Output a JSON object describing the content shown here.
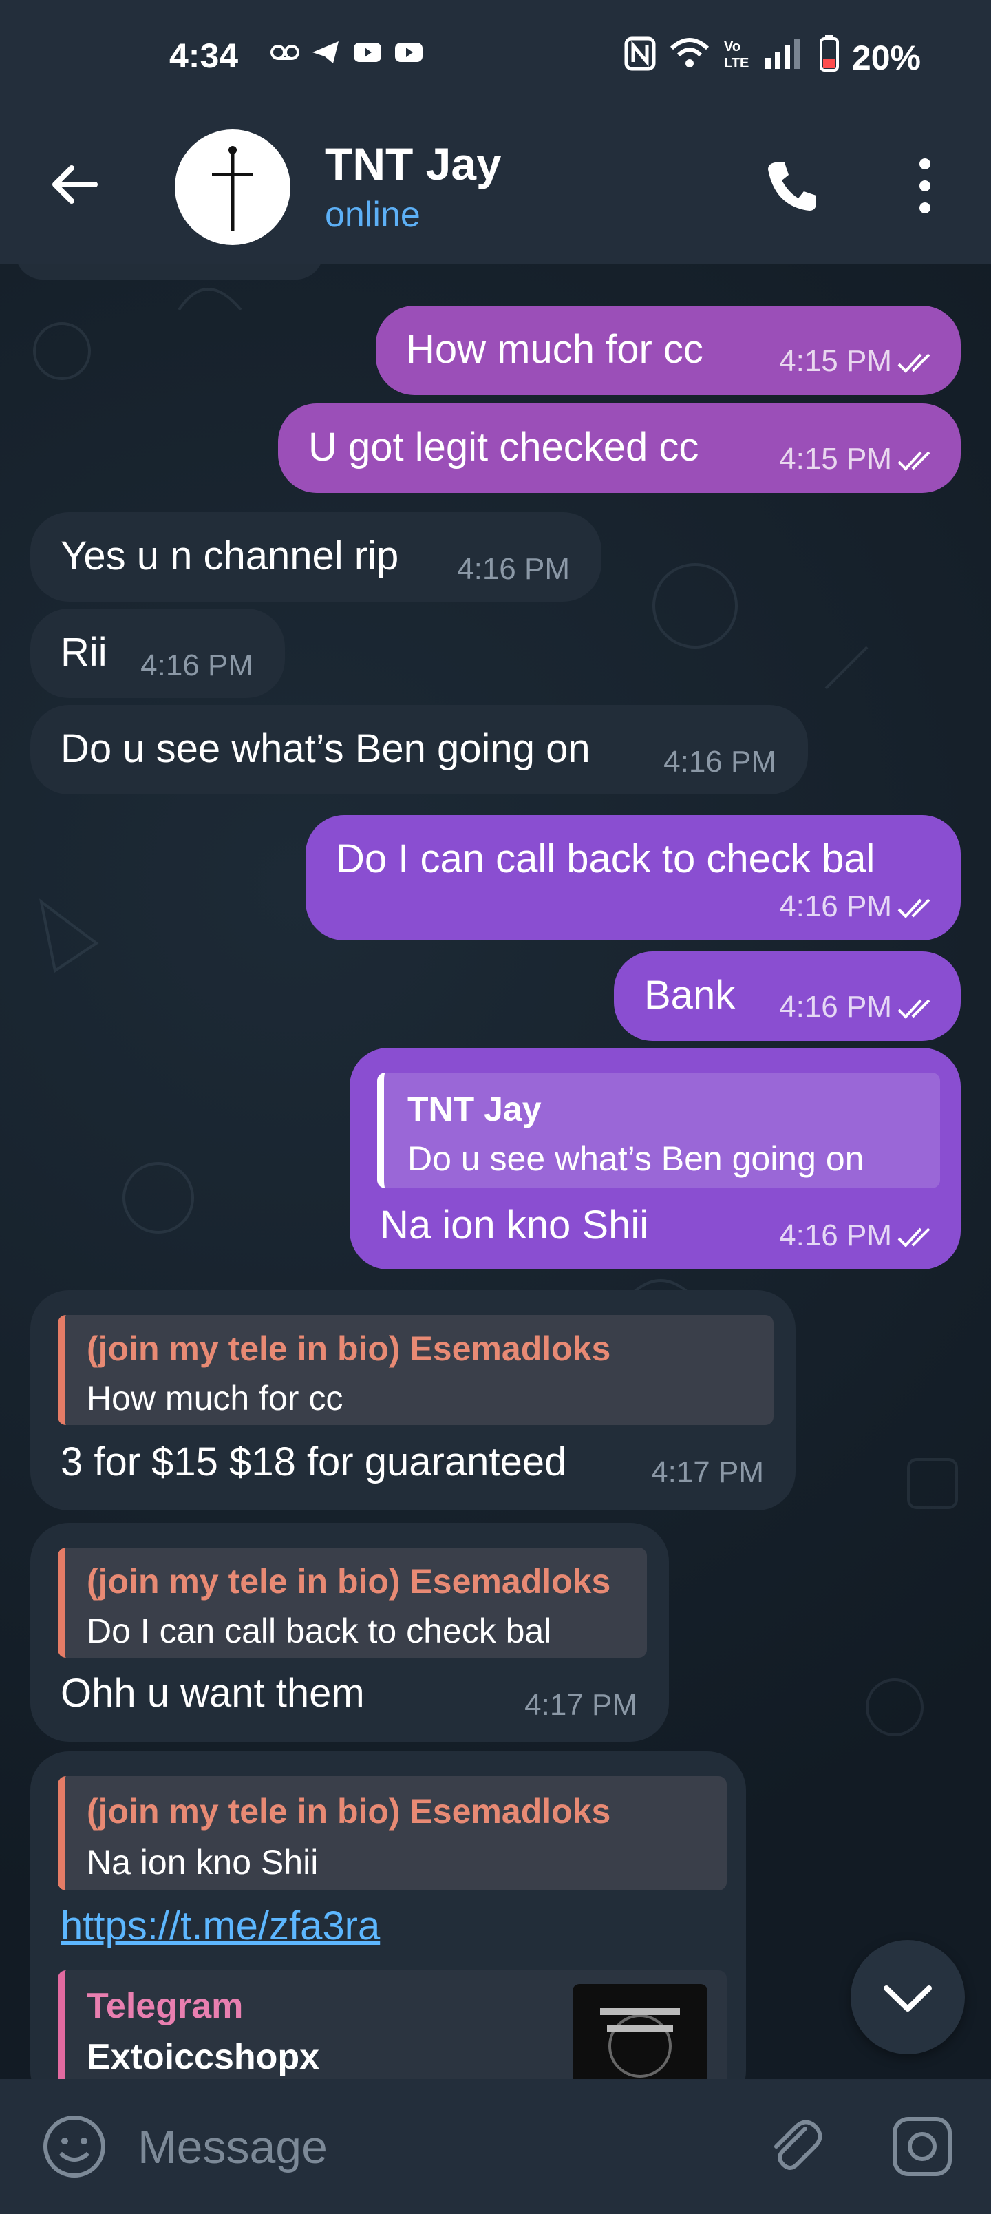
{
  "status": {
    "time": "4:34",
    "battery": "20%"
  },
  "header": {
    "title": "TNT Jay",
    "subtitle": "online"
  },
  "messages": [
    {
      "text": "How much for cc",
      "time": "4:15 PM"
    },
    {
      "text": "U got legit checked cc",
      "time": "4:15 PM"
    },
    {
      "text": "Yes u n channel rip",
      "time": "4:16 PM"
    },
    {
      "text": "Rii",
      "time": "4:16 PM"
    },
    {
      "text": "Do u see what’s Ben going on",
      "time": "4:16 PM"
    },
    {
      "text": "Do I can call back to check bal",
      "time": "4:16 PM"
    },
    {
      "text": "Bank",
      "time": "4:16 PM"
    },
    {
      "reply_name": "TNT Jay",
      "reply_text": "Do u see what’s Ben going on",
      "text": "Na ion kno Shii",
      "time": "4:16 PM"
    },
    {
      "reply_name": "(join my tele in bio) Esemadloks",
      "reply_text": "How much for cc",
      "text": "3 for $15 $18 for guaranteed",
      "time": "4:17 PM"
    },
    {
      "reply_name": "(join my tele in bio) Esemadloks",
      "reply_text": "Do I can call back to check bal",
      "text": "Ohh u want them",
      "time": "4:17 PM"
    },
    {
      "reply_name": "(join my tele in bio) Esemadloks",
      "reply_text": "Na ion kno Shii",
      "link": "https://t.me/zfa3ra",
      "preview_site": "Telegram",
      "preview_title": "Extoiccshopx"
    }
  ],
  "composer": {
    "placeholder": "Message"
  },
  "colors": {
    "outgoing": "#9b4fb8",
    "incoming": "#222d39",
    "accent": "#5db0f6"
  }
}
